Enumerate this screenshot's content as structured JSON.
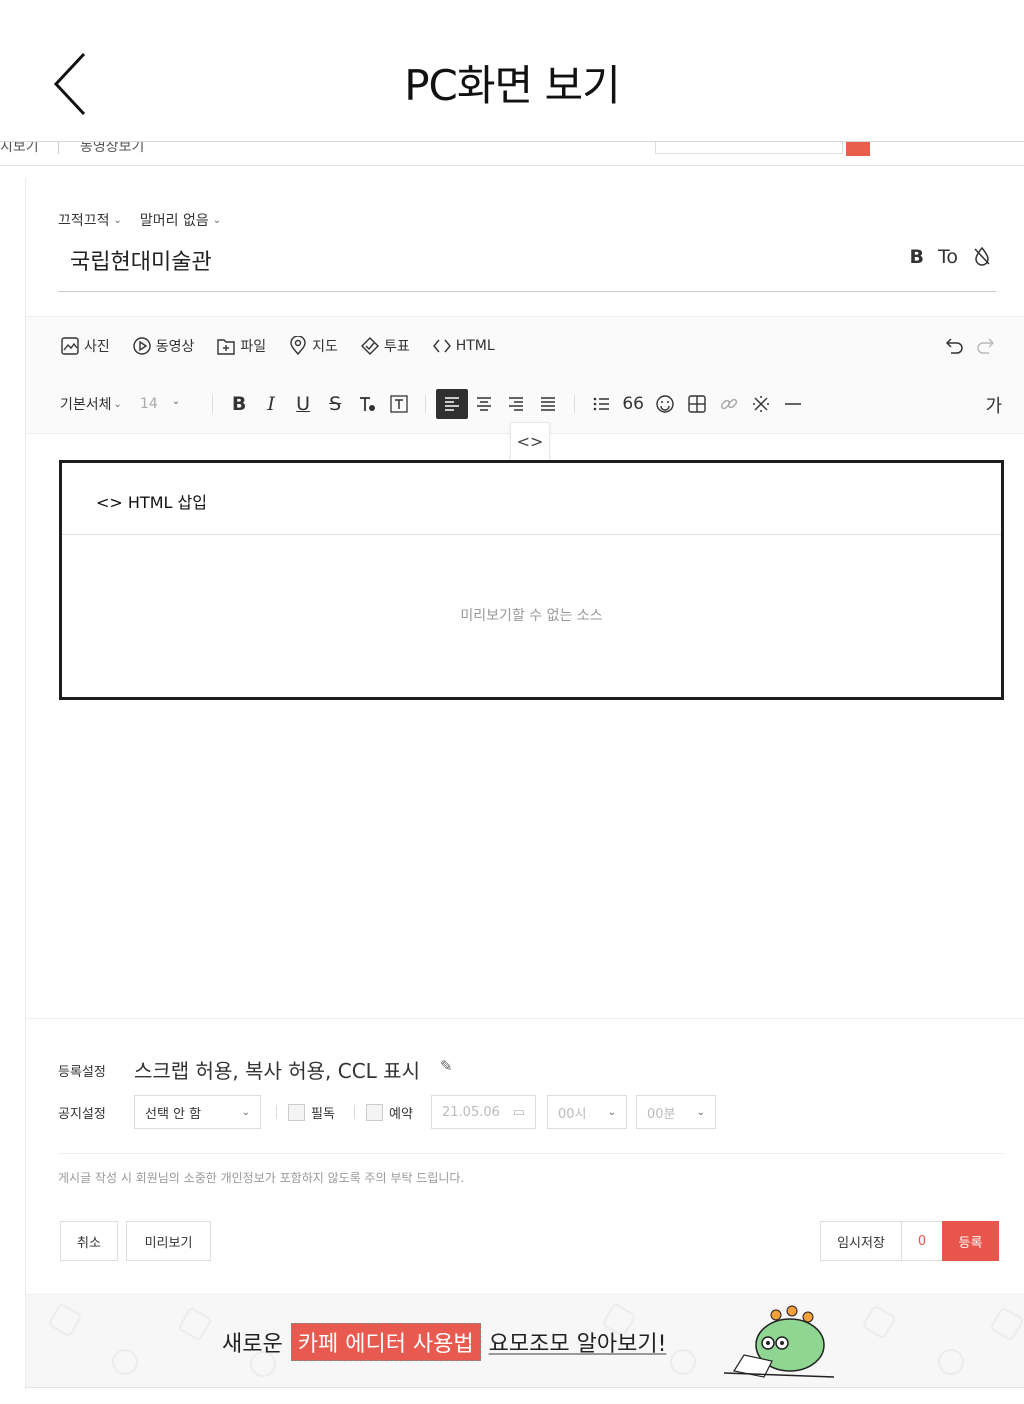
{
  "header": {
    "title": "PC화면 보기"
  },
  "strip": {
    "left_cut": "지보기",
    "middle_cut": "동영상보기"
  },
  "editor": {
    "category": "끄적끄적",
    "prefix": "말머리 없음",
    "post_title": "국립현대미술관",
    "title_tools": {
      "bold": "B",
      "text": "To"
    },
    "toolbar1": {
      "photo": "사진",
      "video": "동영상",
      "file": "파일",
      "map": "지도",
      "vote": "투표",
      "html": "HTML"
    },
    "toolbar2": {
      "font": "기본서체",
      "size": "14",
      "bold": "B",
      "italic": "I",
      "underline": "U",
      "strike": "S",
      "quote": "66",
      "spell": "가"
    },
    "tooltip": "<>",
    "html_box": {
      "header": "<> HTML 삽입",
      "message": "미리보기할 수 없는 소스"
    }
  },
  "settings": {
    "register_label": "등록설정",
    "register_value": "스크랩 허용, 복사 허용, CCL 표시",
    "notice_label": "공지설정",
    "notice_select": "선택 안 함",
    "must_read": "필독",
    "reserve": "예약",
    "date": "21.05.06",
    "hour": "00시",
    "minute": "00분",
    "notice_text": "게시글 작성 시 회원님의 소중한 개인정보가 포함하지 않도록 주의 부탁 드립니다."
  },
  "buttons": {
    "cancel": "취소",
    "preview": "미리보기",
    "temp_save": "임시저장",
    "temp_count": "0",
    "submit": "등록"
  },
  "banner": {
    "before": "새로운",
    "highlight": "카페 에디터 사용법",
    "after": "요모조모 알아보기!"
  },
  "colors": {
    "accent": "#e8554b",
    "active_tool": "#303030"
  }
}
